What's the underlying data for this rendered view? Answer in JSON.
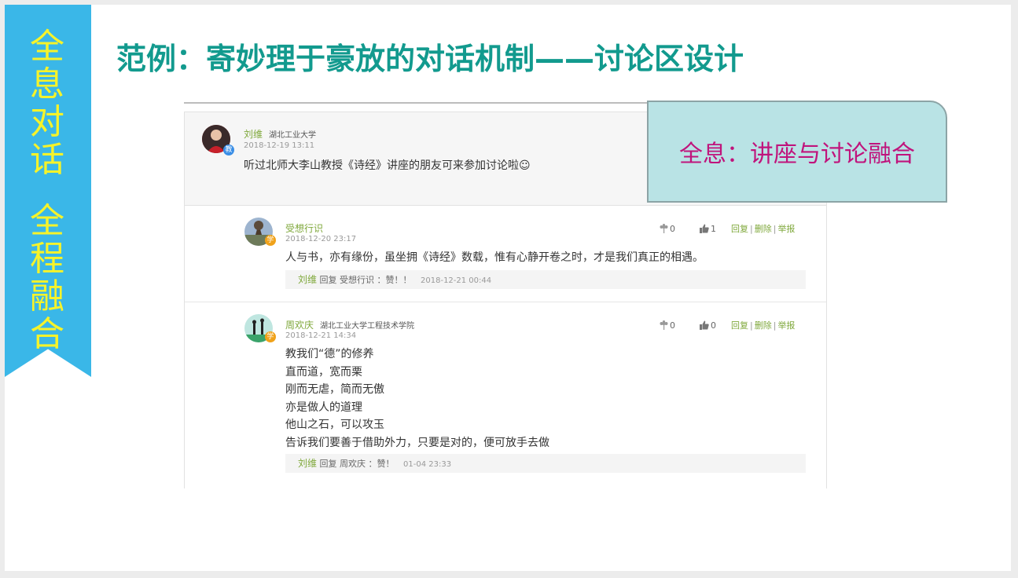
{
  "ribbon": {
    "line1": "全息对话",
    "line2": "全程融合"
  },
  "title": "范例：寄妙理于豪放的对话机制——讨论区设计",
  "callout": "全息：讲座与讨论融合",
  "main_post": {
    "author": "刘维",
    "org": "湖北工业大学",
    "badge": "教",
    "time": "2018-12-19 13:11",
    "content": "听过北师大李山教授《诗经》讲座的朋友可来参加讨论啦☺"
  },
  "replies": [
    {
      "author": "受想行识",
      "org": "",
      "badge": "学",
      "time": "2018-12-20 23:17",
      "content_lines": [
        "人与书，亦有缘份，虽坐拥《诗经》数载，惟有心静开卷之时，才是我们真正的相遇。"
      ],
      "flower_count": "0",
      "like_count": "1",
      "actions": [
        "回复",
        "删除",
        "举报"
      ],
      "subreply": {
        "author": "刘维",
        "text": "回复 受想行识 ：赞！！",
        "time": "2018-12-21 00:44"
      }
    },
    {
      "author": "周欢庆",
      "org": "湖北工业大学工程技术学院",
      "badge": "学",
      "time": "2018-12-21 14:34",
      "content_lines": [
        "教我们“德”的修养",
        "直而道，宽而栗",
        "刚而无虐，简而无傲",
        "亦是做人的道理",
        "他山之石，可以攻玉",
        "告诉我们要善于借助外力，只要是对的，便可放手去做"
      ],
      "flower_count": "0",
      "like_count": "0",
      "actions": [
        "回复",
        "删除",
        "举报"
      ],
      "subreply": {
        "author": "刘维",
        "text": "回复 周欢庆 ：赞！",
        "time": "01-04 23:33"
      }
    }
  ],
  "colors": {
    "ribbon": "#3ab7e8",
    "ribbon_text": "#f6f32a",
    "title": "#129a8e",
    "callout_bg": "#b9e3e5",
    "callout_text": "#c0147c",
    "username": "#7fa83b"
  },
  "icons": {
    "flower": "flower-icon",
    "like": "thumbs-up-icon"
  }
}
